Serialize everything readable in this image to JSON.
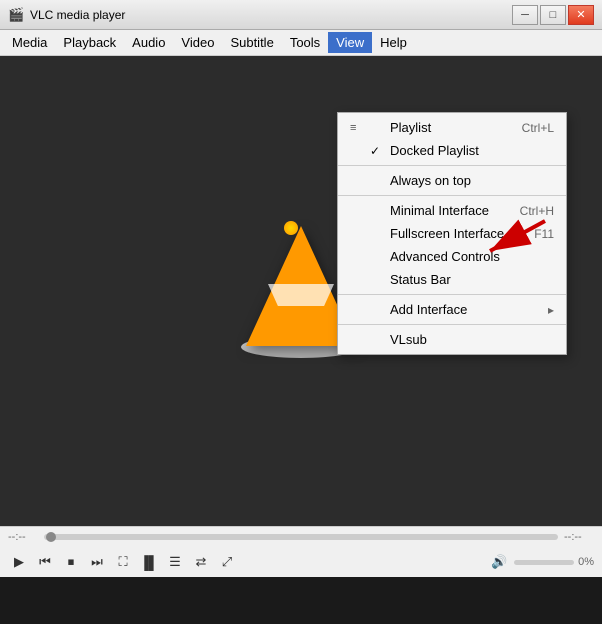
{
  "window": {
    "title": "VLC media player",
    "title_icon": "🎬"
  },
  "titlebar": {
    "minimize": "─",
    "maximize": "□",
    "close": "✕"
  },
  "menubar": {
    "items": [
      {
        "label": "Media",
        "id": "media"
      },
      {
        "label": "Playback",
        "id": "playback"
      },
      {
        "label": "Audio",
        "id": "audio"
      },
      {
        "label": "Video",
        "id": "video"
      },
      {
        "label": "Subtitle",
        "id": "subtitle"
      },
      {
        "label": "Tools",
        "id": "tools"
      },
      {
        "label": "View",
        "id": "view",
        "active": true
      },
      {
        "label": "Help",
        "id": "help"
      }
    ]
  },
  "dropdown": {
    "items": [
      {
        "id": "playlist",
        "icon": "≡",
        "check": "",
        "label": "Playlist",
        "shortcut": "Ctrl+L",
        "divider_after": false
      },
      {
        "id": "docked-playlist",
        "icon": "",
        "check": "✓",
        "label": "Docked Playlist",
        "shortcut": "",
        "divider_after": true
      },
      {
        "id": "always-on-top",
        "icon": "",
        "check": "",
        "label": "Always on top",
        "shortcut": "",
        "divider_after": false
      },
      {
        "id": "minimal-interface",
        "icon": "",
        "check": "",
        "label": "Minimal Interface",
        "shortcut": "Ctrl+H",
        "divider_after": false
      },
      {
        "id": "fullscreen-interface",
        "icon": "",
        "check": "",
        "label": "Fullscreen Interface",
        "shortcut": "F11",
        "divider_after": false
      },
      {
        "id": "advanced-controls",
        "icon": "",
        "check": "",
        "label": "Advanced Controls",
        "shortcut": "",
        "divider_after": false
      },
      {
        "id": "status-bar",
        "icon": "",
        "check": "",
        "label": "Status Bar",
        "shortcut": "",
        "divider_after": true
      },
      {
        "id": "add-interface",
        "icon": "",
        "check": "",
        "label": "Add Interface",
        "shortcut": "▶",
        "divider_after": true
      },
      {
        "id": "vlsub",
        "icon": "",
        "check": "",
        "label": "VLsub",
        "shortcut": "",
        "divider_after": false
      }
    ]
  },
  "controls": {
    "time_start": "--:--",
    "time_end": "--:--",
    "volume_label": "0%",
    "buttons": {
      "play": "▶",
      "prev": "⏮",
      "stop": "⏹",
      "next": "⏭",
      "fullscreen": "⛶",
      "extended": "|||",
      "playlist_btn": "☰",
      "loop": "⇄",
      "random": "⤢",
      "mute": "🔊"
    }
  }
}
